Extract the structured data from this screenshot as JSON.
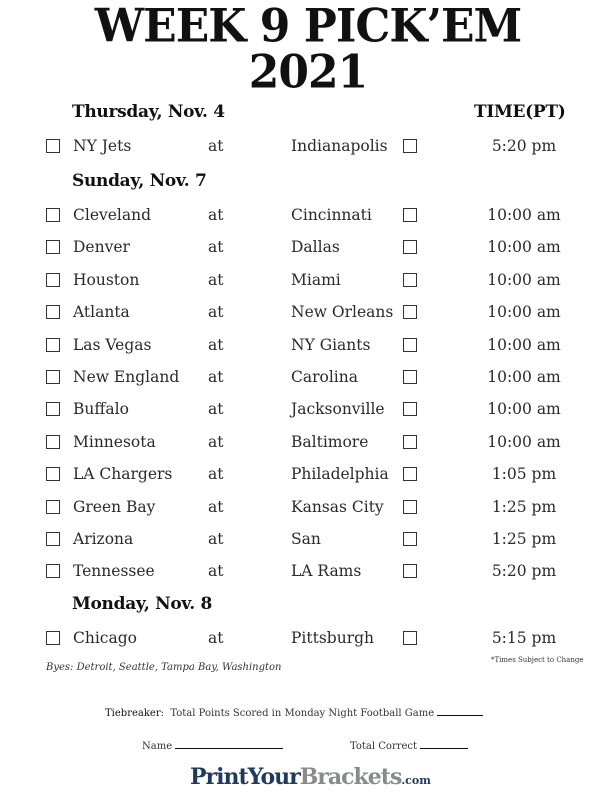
{
  "title": {
    "line1": "WEEK 9 PICK’EM",
    "line2": "2021"
  },
  "time_header": "TIME(PT)",
  "at_label": "at",
  "sections": [
    {
      "day": "Thursday, Nov. 4",
      "games": [
        {
          "away": "NY Jets",
          "home": "Indianapolis",
          "time": "5:20 pm"
        }
      ]
    },
    {
      "day": "Sunday, Nov. 7",
      "games": [
        {
          "away": "Cleveland",
          "home": "Cincinnati",
          "time": "10:00 am"
        },
        {
          "away": "Denver",
          "home": "Dallas",
          "time": "10:00 am"
        },
        {
          "away": "Houston",
          "home": "Miami",
          "time": "10:00 am"
        },
        {
          "away": "Atlanta",
          "home": "New Orleans",
          "time": "10:00 am"
        },
        {
          "away": "Las Vegas",
          "home": "NY Giants",
          "time": "10:00 am"
        },
        {
          "away": "New England",
          "home": "Carolina",
          "time": "10:00 am"
        },
        {
          "away": "Buffalo",
          "home": "Jacksonville",
          "time": "10:00 am"
        },
        {
          "away": "Minnesota",
          "home": "Baltimore",
          "time": "10:00 am"
        },
        {
          "away": "LA Chargers",
          "home": "Philadelphia",
          "time": "1:05 pm"
        },
        {
          "away": "Green Bay",
          "home": "Kansas City",
          "time": "1:25 pm"
        },
        {
          "away": "Arizona",
          "home": "San",
          "time": "1:25 pm"
        },
        {
          "away": "Tennessee",
          "home": "LA Rams",
          "time": "5:20 pm"
        }
      ]
    },
    {
      "day": "Monday, Nov. 8",
      "games": [
        {
          "away": "Chicago",
          "home": "Pittsburgh",
          "time": "5:15 pm"
        }
      ]
    }
  ],
  "byes": "Byes: Detroit, Seattle, Tampa Bay, Washington",
  "times_note": "*Times Subject to Change",
  "tiebreaker": {
    "label": "Tiebreaker:",
    "text": "Total Points Scored in Monday Night Football Game"
  },
  "name_label": "Name",
  "total_correct_label": "Total Correct",
  "logo": {
    "part1": "PrintYour",
    "part2": "Brackets",
    "part3": ".com"
  },
  "colors": {
    "logo_primary": "#1f3a5f",
    "logo_secondary": "#888a8c"
  }
}
